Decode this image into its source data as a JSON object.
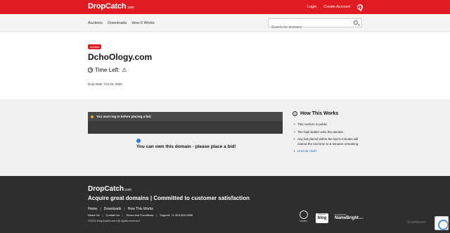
{
  "header": {
    "brand": "DropCatch",
    "brand_suffix": ".com",
    "login": "Login",
    "create_account": "Create Account",
    "accent_color": "#e01b22"
  },
  "nav": {
    "items": [
      "Auctions",
      "Downloads",
      "How It Works"
    ],
    "search_placeholder": "Search for domains"
  },
  "auction": {
    "badge": "Auction",
    "domain": "DchoOlogy.com",
    "time_left_label": "Time Left:",
    "drop_date": "Drop Date: Oct 20, 2025"
  },
  "bid_panel": {
    "login_notice": "You must log in before placing a bid.",
    "own_message": "You can own this domain - please place a bid!"
  },
  "how_it_works": {
    "title": "How This Works",
    "items": [
      "This Auction is public.",
      "The high bidder wins the domain.",
      "Any bid placed within the last 5 minutes will extend the end time to 5 minutes remaining."
    ],
    "link": "How do I bid?"
  },
  "footer": {
    "brand": "DropCatch",
    "brand_suffix": ".com",
    "tagline": "Acquire great domains | Committed to customer satisfaction",
    "links": [
      "Home",
      "Downloads",
      "How This Works"
    ],
    "links2": [
      "About Us",
      "Contact Us",
      "Terms and Conditions",
      "Support: +1-303-502-9598"
    ],
    "copyright": "©2020 DropCatch.com All rights reserved.",
    "icann": "ICANN",
    "blog_small": "DropCatch",
    "blog_big": "blog",
    "nb_powered": "POWERED BY",
    "nb_name": "NameBright",
    "nb_suffix": ".com"
  },
  "overlay": {
    "watermark": "ScanMaster"
  }
}
